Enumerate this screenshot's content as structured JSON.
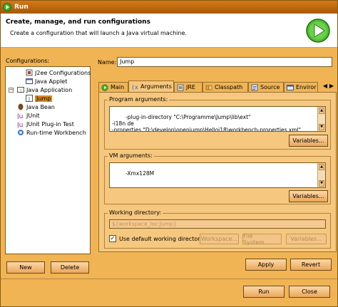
{
  "window": {
    "title": "Run"
  },
  "header": {
    "title": "Create, manage, and run configurations",
    "description": "Create a configuration that will launch a Java virtual machine."
  },
  "configurations": {
    "label": "Configurations:",
    "tree": [
      {
        "label": "J2ee Configurations",
        "icon": "j2ee-icon"
      },
      {
        "label": "Java Applet",
        "icon": "applet-icon"
      },
      {
        "label": "Java Application",
        "icon": "java-application-icon",
        "expanded": true
      },
      {
        "label": "Jump",
        "icon": "java-class-icon",
        "selected": true
      },
      {
        "label": "Java Bean",
        "icon": "bean-icon"
      },
      {
        "label": "JUnit",
        "icon": "junit-icon"
      },
      {
        "label": "JUnit Plug-in Test",
        "icon": "junit-plugin-icon"
      },
      {
        "label": "Run-time Workbench",
        "icon": "workbench-icon"
      }
    ],
    "new_label": "New",
    "delete_label": "Delete"
  },
  "name": {
    "label": "Name:",
    "value": "Jump"
  },
  "tabs": [
    {
      "label": "Main",
      "icon": "main-icon"
    },
    {
      "label": "Arguments",
      "icon": "arguments-icon",
      "active": true
    },
    {
      "label": "JRE",
      "icon": "jre-icon"
    },
    {
      "label": "Classpath",
      "icon": "classpath-icon"
    },
    {
      "label": "Source",
      "icon": "source-icon"
    },
    {
      "label": "Enviror",
      "icon": "environment-icon"
    }
  ],
  "program_arguments": {
    "label": "Program arguments:",
    "value": "-plug-in-directory \"C:\\Programme\\Jump\\lib\\ext\"\n-i18n de\n-properties \"D:\\develop\\openjump\\Helloi18\\workbench-properties.xml\"",
    "variables_label": "Variables..."
  },
  "vm_arguments": {
    "label": "VM arguments:",
    "value": "-Xmx128M",
    "variables_label": "Variables..."
  },
  "working_directory": {
    "label": "Working directory:",
    "value": "${workspace_loc:Jump}",
    "use_default_label": "Use default working directory",
    "use_default_checked": true,
    "workspace_label": "Workspace...",
    "filesystem_label": "File System...",
    "variables_label": "Variables..."
  },
  "actions": {
    "apply_label": "Apply",
    "revert_label": "Revert",
    "run_label": "Run",
    "close_label": "Close"
  },
  "colors": {
    "window_bg": "#f0b454",
    "title_bar": "#c06a10",
    "selection": "#d88a2a",
    "play_green": "#3fae2a"
  }
}
